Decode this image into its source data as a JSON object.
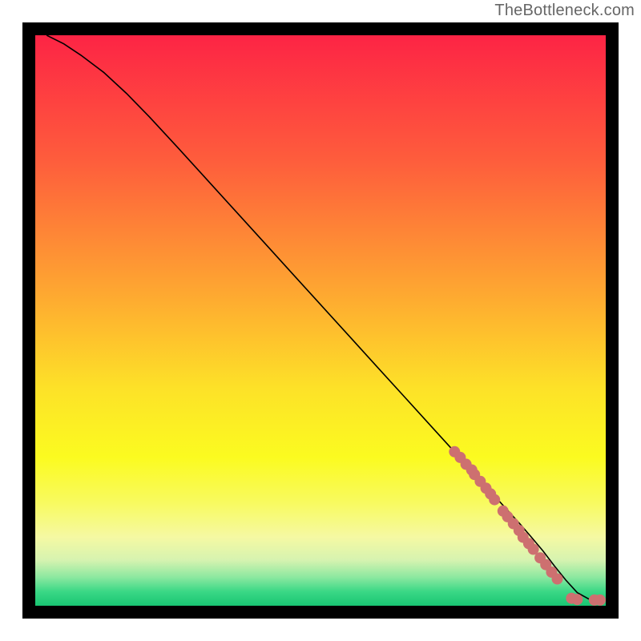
{
  "attribution": "TheBottleneck.com",
  "chart_data": {
    "type": "line",
    "title": "",
    "xlabel": "",
    "ylabel": "",
    "xlim": [
      0,
      100
    ],
    "ylim": [
      0,
      100
    ],
    "grid": false,
    "legend": false,
    "series": [
      {
        "name": "curve",
        "type": "line",
        "color": "#000000",
        "x": [
          2,
          5,
          8,
          12,
          16,
          20,
          25,
          30,
          35,
          40,
          45,
          50,
          55,
          60,
          65,
          70,
          73,
          76,
          79,
          82,
          85,
          87,
          89,
          91,
          93,
          95,
          97,
          99
        ],
        "y": [
          100,
          98.5,
          96.5,
          93.5,
          89.8,
          85.7,
          80.3,
          74.8,
          69.3,
          63.8,
          58.3,
          52.8,
          47.3,
          41.8,
          36.3,
          30.8,
          27.5,
          24.2,
          20.9,
          17.6,
          14.3,
          12.0,
          9.6,
          7.0,
          4.5,
          2.3,
          1.2,
          1.0
        ]
      },
      {
        "name": "markers",
        "type": "scatter",
        "color": "#cd7070",
        "x": [
          73.5,
          74.5,
          75.5,
          76.5,
          77.0,
          78.0,
          79.0,
          79.8,
          80.5,
          82.0,
          82.8,
          83.8,
          84.8,
          85.5,
          86.5,
          87.3,
          88.5,
          89.5,
          90.5,
          91.5,
          94.0,
          95.0,
          98.0,
          99.0
        ],
        "y": [
          27.0,
          26.0,
          24.8,
          23.8,
          23.0,
          21.8,
          20.6,
          19.6,
          18.6,
          16.6,
          15.6,
          14.4,
          13.2,
          12.0,
          10.9,
          9.9,
          8.4,
          7.2,
          5.9,
          4.7,
          1.3,
          1.1,
          1.0,
          1.0
        ]
      }
    ],
    "background_gradient": {
      "stops": [
        {
          "pct": 0,
          "color": "#fd2445"
        },
        {
          "pct": 22,
          "color": "#fe5d3c"
        },
        {
          "pct": 45,
          "color": "#fea731"
        },
        {
          "pct": 62,
          "color": "#fde228"
        },
        {
          "pct": 74,
          "color": "#fbfb20"
        },
        {
          "pct": 82,
          "color": "#f8fa60"
        },
        {
          "pct": 88,
          "color": "#f5f9a3"
        },
        {
          "pct": 92,
          "color": "#d6f3b0"
        },
        {
          "pct": 95,
          "color": "#8ce8a0"
        },
        {
          "pct": 97.5,
          "color": "#3bd886"
        },
        {
          "pct": 100,
          "color": "#18c572"
        }
      ]
    }
  }
}
